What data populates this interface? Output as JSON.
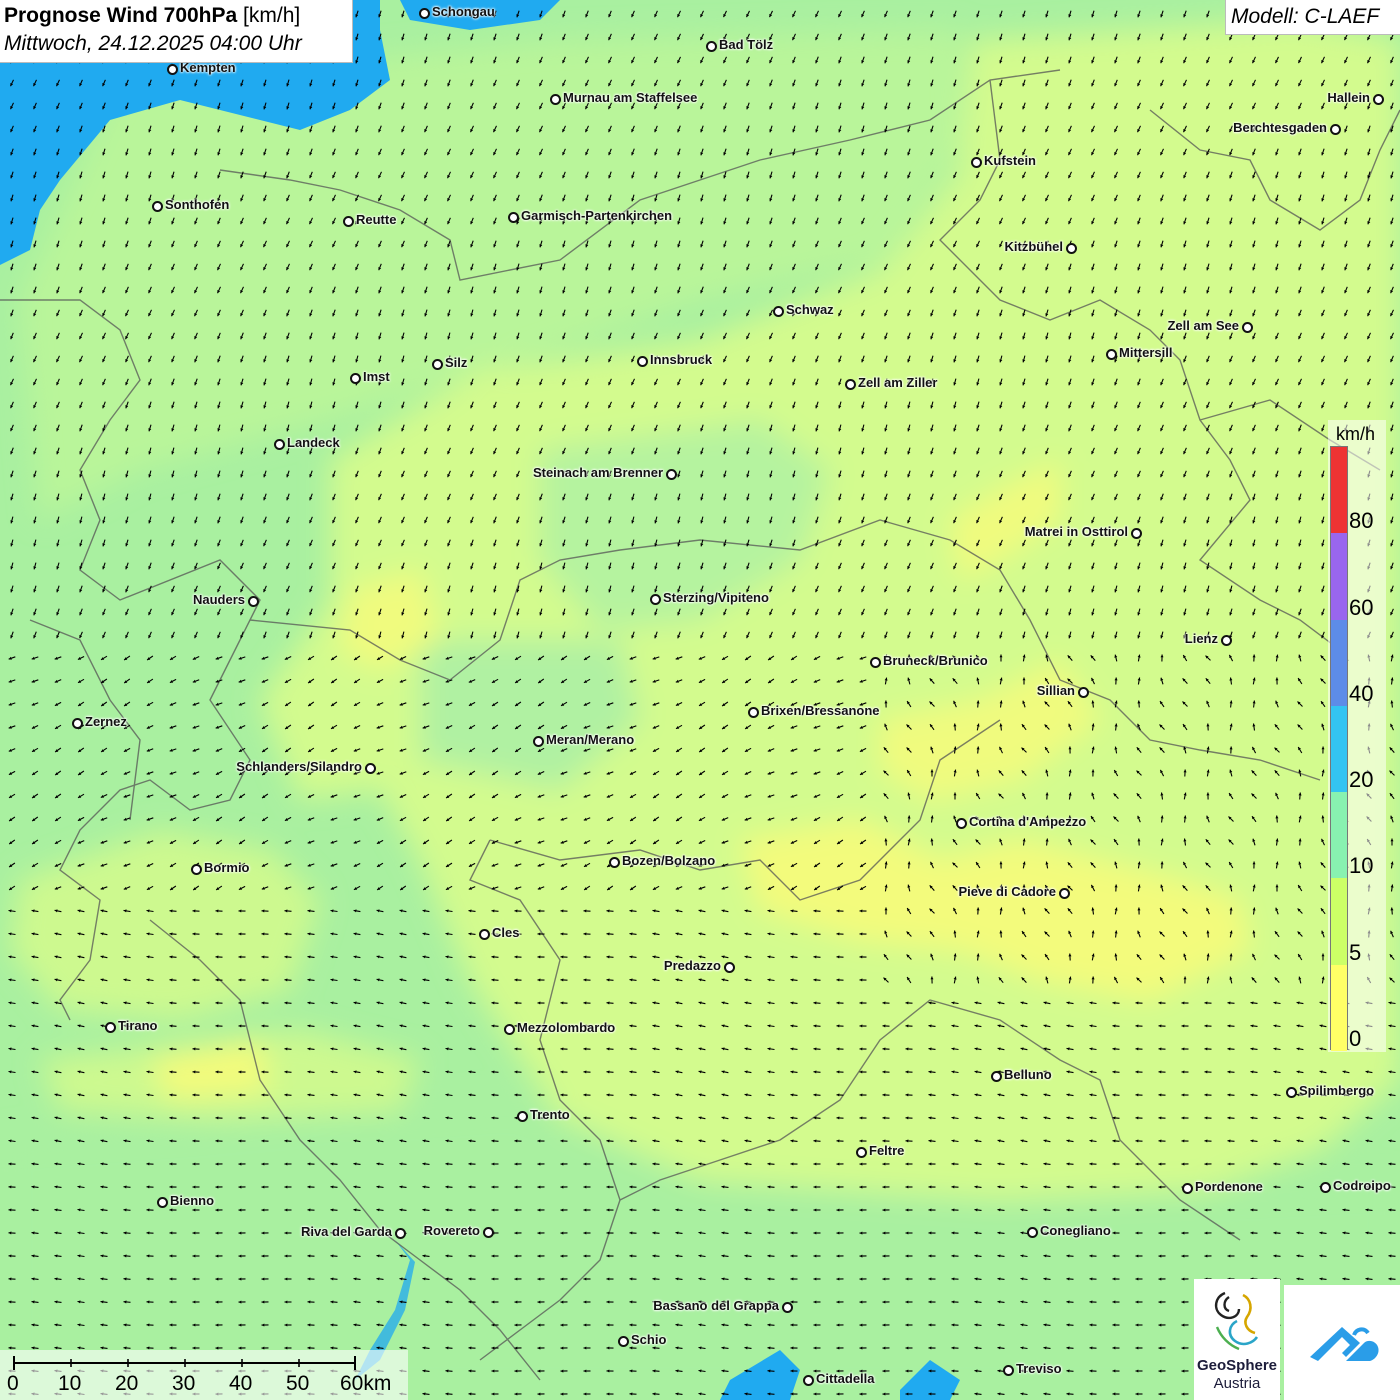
{
  "header": {
    "title_bold": "Prognose Wind 700hPa",
    "title_unit": "[km/h]",
    "subtitle": "Mittwoch, 24.12.2025 04:00 Uhr",
    "model": "Modell: C-LAEF"
  },
  "legend": {
    "unit": "km/h",
    "ticks": [
      "0",
      "5",
      "10",
      "20",
      "40",
      "60",
      "80"
    ],
    "colors": [
      "#ffff66",
      "#ccff66",
      "#88f2b0",
      "#33c4f2",
      "#5d8ce8",
      "#9966ee",
      "#ee3333"
    ]
  },
  "scale": {
    "labels": [
      "0",
      "10",
      "20",
      "30",
      "40",
      "50",
      "60km"
    ]
  },
  "logos": {
    "geosphere_line1": "GeoSphere",
    "geosphere_line2": "Austria",
    "geosphere_icon": "geosphere-logo-icon",
    "app_icon": "cloud-arrow-logo-icon"
  },
  "map": {
    "field_colors": {
      "light_blue": "#20aaf0",
      "green_light": "#a9f0a0",
      "green": "#b9f59a",
      "lime": "#d3fb8e",
      "yellow": "#f3fb7c"
    },
    "arrow_color": "#000000",
    "cities": [
      {
        "name": "Schongau"
      },
      {
        "name": "Bad Tölz"
      },
      {
        "name": "Kempten"
      },
      {
        "name": "Murnau am Staffelsee"
      },
      {
        "name": "Hallein"
      },
      {
        "name": "Berchtesgaden"
      },
      {
        "name": "Kufstein"
      },
      {
        "name": "Sonthofen"
      },
      {
        "name": "Reutte"
      },
      {
        "name": "Garmisch-Partenkirchen"
      },
      {
        "name": "Kitzbühel"
      },
      {
        "name": "Schwaz"
      },
      {
        "name": "Zell am See"
      },
      {
        "name": "Mittersill"
      },
      {
        "name": "Innsbruck"
      },
      {
        "name": "Silz"
      },
      {
        "name": "Imst"
      },
      {
        "name": "Zell am Ziller"
      },
      {
        "name": "Landeck"
      },
      {
        "name": "Steinach am Brenner"
      },
      {
        "name": "Matrei in Osttirol"
      },
      {
        "name": "Nauders"
      },
      {
        "name": "Sterzing/Vipiteno"
      },
      {
        "name": "Lienz"
      },
      {
        "name": "Bruneck/Brunico"
      },
      {
        "name": "Sillian"
      },
      {
        "name": "Brixen/Bressanone"
      },
      {
        "name": "Zernez"
      },
      {
        "name": "Meran/Merano"
      },
      {
        "name": "Schlanders/Silandro"
      },
      {
        "name": "Cortina d'Ampezzo"
      },
      {
        "name": "Bozen/Bolzano"
      },
      {
        "name": "Bormio"
      },
      {
        "name": "Pieve di Cadore"
      },
      {
        "name": "Cles"
      },
      {
        "name": "Predazzo"
      },
      {
        "name": "Tirano"
      },
      {
        "name": "Mezzolombardo"
      },
      {
        "name": "Belluno"
      },
      {
        "name": "Spilimbergo"
      },
      {
        "name": "Trento"
      },
      {
        "name": "Feltre"
      },
      {
        "name": "Pordenone"
      },
      {
        "name": "Codroipo"
      },
      {
        "name": "Bienno"
      },
      {
        "name": "Riva del Garda"
      },
      {
        "name": "Rovereto"
      },
      {
        "name": "Conegliano"
      },
      {
        "name": "Bassano del Grappa"
      },
      {
        "name": "Schio"
      },
      {
        "name": "Treviso"
      },
      {
        "name": "Cittadella"
      }
    ]
  }
}
